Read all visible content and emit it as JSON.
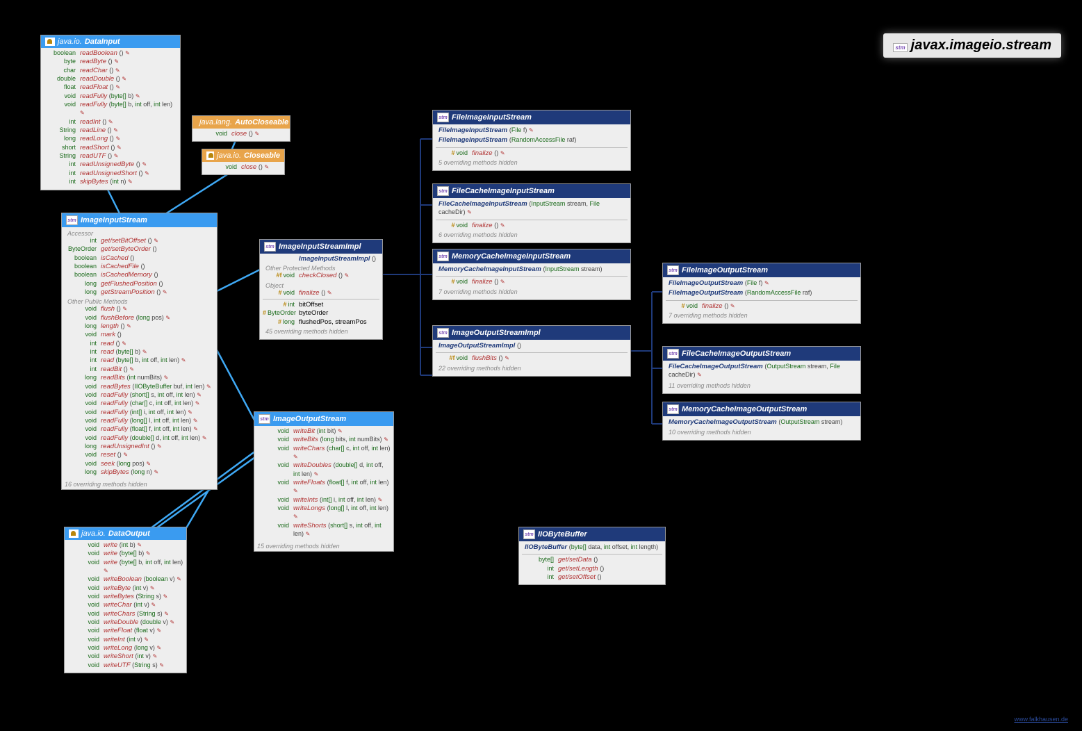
{
  "title": "javax.imageio.stream",
  "footer": "www.falkhausen.de",
  "colors": {
    "blue": "#3a9bf0",
    "navy": "#1f3a7a",
    "orange": "#e8a44a",
    "method": "#b03030",
    "type": "#1a6a1a"
  },
  "boxes": {
    "DataInput": {
      "header": {
        "pkg": "java.io.",
        "name": "DataInput",
        "style": "blue",
        "icon": "j"
      },
      "rows": [
        {
          "ret": "boolean",
          "name": "readBoolean",
          "params": "()",
          "e": true
        },
        {
          "ret": "byte",
          "name": "readByte",
          "params": "()",
          "e": true
        },
        {
          "ret": "char",
          "name": "readChar",
          "params": "()",
          "e": true
        },
        {
          "ret": "double",
          "name": "readDouble",
          "params": "()",
          "e": true
        },
        {
          "ret": "float",
          "name": "readFloat",
          "params": "()",
          "e": true
        },
        {
          "ret": "void",
          "name": "readFully",
          "params": "(byte[] b)",
          "e": true
        },
        {
          "ret": "void",
          "name": "readFully",
          "params": "(byte[] b, int off, int len)",
          "e": true
        },
        {
          "ret": "int",
          "name": "readInt",
          "params": "()",
          "e": true
        },
        {
          "ret": "String",
          "name": "readLine",
          "params": "()",
          "e": true
        },
        {
          "ret": "long",
          "name": "readLong",
          "params": "()",
          "e": true
        },
        {
          "ret": "short",
          "name": "readShort",
          "params": "()",
          "e": true
        },
        {
          "ret": "String",
          "name": "readUTF",
          "params": "()",
          "e": true
        },
        {
          "ret": "int",
          "name": "readUnsignedByte",
          "params": "()",
          "e": true
        },
        {
          "ret": "int",
          "name": "readUnsignedShort",
          "params": "()",
          "e": true
        },
        {
          "ret": "int",
          "name": "skipBytes",
          "params": "(int n)",
          "e": true
        }
      ]
    },
    "AutoCloseable": {
      "header": {
        "pkg": "java.lang.",
        "name": "AutoCloseable",
        "style": "orange",
        "icon": "cup"
      },
      "rows": [
        {
          "ret": "void",
          "name": "close",
          "params": "()",
          "e": true
        }
      ]
    },
    "Closeable": {
      "header": {
        "pkg": "java.io.",
        "name": "Closeable",
        "style": "orange",
        "icon": "j"
      },
      "rows": [
        {
          "ret": "void",
          "name": "close",
          "params": "()",
          "e": true
        }
      ]
    },
    "ImageInputStream": {
      "header": {
        "pkg": "",
        "name": "ImageInputStream",
        "style": "blue",
        "icon": "stm"
      },
      "sections": [
        {
          "title": "Accessor",
          "rows": [
            {
              "ret": "int",
              "name": "get/setBitOffset",
              "params": "()",
              "e": true
            },
            {
              "ret": "ByteOrder",
              "name": "get/setByteOrder",
              "params": "()"
            },
            {
              "ret": "boolean",
              "name": "isCached",
              "params": "()"
            },
            {
              "ret": "boolean",
              "name": "isCachedFile",
              "params": "()"
            },
            {
              "ret": "boolean",
              "name": "isCachedMemory",
              "params": "()"
            },
            {
              "ret": "long",
              "name": "getFlushedPosition",
              "params": "()"
            },
            {
              "ret": "long",
              "name": "getStreamPosition",
              "params": "()",
              "e": true
            }
          ]
        },
        {
          "title": "Other Public Methods",
          "rows": [
            {
              "ret": "void",
              "name": "flush",
              "params": "()",
              "e": true
            },
            {
              "ret": "void",
              "name": "flushBefore",
              "params": "(long pos)",
              "e": true
            },
            {
              "ret": "long",
              "name": "length",
              "params": "()",
              "e": true
            },
            {
              "ret": "void",
              "name": "mark",
              "params": "()"
            },
            {
              "ret": "int",
              "name": "read",
              "params": "()",
              "e": true
            },
            {
              "ret": "int",
              "name": "read",
              "params": "(byte[] b)",
              "e": true
            },
            {
              "ret": "int",
              "name": "read",
              "params": "(byte[] b, int off, int len)",
              "e": true
            },
            {
              "ret": "int",
              "name": "readBit",
              "params": "()",
              "e": true
            },
            {
              "ret": "long",
              "name": "readBits",
              "params": "(int numBits)",
              "e": true
            },
            {
              "ret": "void",
              "name": "readBytes",
              "params": "(IIOByteBuffer buf, int len)",
              "e": true
            },
            {
              "ret": "void",
              "name": "readFully",
              "params": "(short[] s, int off, int len)",
              "e": true
            },
            {
              "ret": "void",
              "name": "readFully",
              "params": "(char[] c, int off, int len)",
              "e": true
            },
            {
              "ret": "void",
              "name": "readFully",
              "params": "(int[] i, int off, int len)",
              "e": true
            },
            {
              "ret": "void",
              "name": "readFully",
              "params": "(long[] l, int off, int len)",
              "e": true
            },
            {
              "ret": "void",
              "name": "readFully",
              "params": "(float[] f, int off, int len)",
              "e": true
            },
            {
              "ret": "void",
              "name": "readFully",
              "params": "(double[] d, int off, int len)",
              "e": true
            },
            {
              "ret": "long",
              "name": "readUnsignedInt",
              "params": "()",
              "e": true
            },
            {
              "ret": "void",
              "name": "reset",
              "params": "()",
              "e": true
            },
            {
              "ret": "void",
              "name": "seek",
              "params": "(long pos)",
              "e": true
            },
            {
              "ret": "long",
              "name": "skipBytes",
              "params": "(long n)",
              "e": true
            }
          ]
        }
      ],
      "hidden": "16 overriding methods hidden"
    },
    "ImageInputStreamImpl": {
      "header": {
        "pkg": "",
        "name": "ImageInputStreamImpl",
        "style": "navy",
        "icon": "stm"
      },
      "ctor": [
        {
          "name": "ImageInputStreamImpl",
          "params": "()"
        }
      ],
      "sections": [
        {
          "title": "Other Protected Methods",
          "rows": [
            {
              "prot": "#f",
              "ret": "void",
              "name": "checkClosed",
              "params": "()",
              "e": true
            }
          ]
        },
        {
          "title": "Object",
          "rows": [
            {
              "prot": "#",
              "ret": "void",
              "name": "finalize",
              "params": "()",
              "e": true
            }
          ]
        }
      ],
      "fields": [
        {
          "prot": "#",
          "ret": "int",
          "name": "bitOffset"
        },
        {
          "prot": "#",
          "ret": "ByteOrder",
          "name": "byteOrder"
        },
        {
          "prot": "#",
          "ret": "long",
          "name": "flushedPos, streamPos"
        }
      ],
      "hidden": "45 overriding methods hidden"
    },
    "ImageOutputStream": {
      "header": {
        "pkg": "",
        "name": "ImageOutputStream",
        "style": "blue",
        "icon": "stm"
      },
      "rows": [
        {
          "ret": "void",
          "name": "writeBit",
          "params": "(int bit)",
          "e": true
        },
        {
          "ret": "void",
          "name": "writeBits",
          "params": "(long bits, int numBits)",
          "e": true
        },
        {
          "ret": "void",
          "name": "writeChars",
          "params": "(char[] c, int off, int len)",
          "e": true
        },
        {
          "ret": "void",
          "name": "writeDoubles",
          "params": "(double[] d, int off, int len)",
          "e": true
        },
        {
          "ret": "void",
          "name": "writeFloats",
          "params": "(float[] f, int off, int len)",
          "e": true
        },
        {
          "ret": "void",
          "name": "writeInts",
          "params": "(int[] i, int off, int len)",
          "e": true
        },
        {
          "ret": "void",
          "name": "writeLongs",
          "params": "(long[] l, int off, int len)",
          "e": true
        },
        {
          "ret": "void",
          "name": "writeShorts",
          "params": "(short[] s, int off, int len)",
          "e": true
        }
      ],
      "hidden": "15 overriding methods hidden"
    },
    "DataOutput": {
      "header": {
        "pkg": "java.io.",
        "name": "DataOutput",
        "style": "blue",
        "icon": "j"
      },
      "rows": [
        {
          "ret": "void",
          "name": "write",
          "params": "(int b)",
          "e": true
        },
        {
          "ret": "void",
          "name": "write",
          "params": "(byte[] b)",
          "e": true
        },
        {
          "ret": "void",
          "name": "write",
          "params": "(byte[] b, int off, int len)",
          "e": true
        },
        {
          "ret": "void",
          "name": "writeBoolean",
          "params": "(boolean v)",
          "e": true
        },
        {
          "ret": "void",
          "name": "writeByte",
          "params": "(int v)",
          "e": true
        },
        {
          "ret": "void",
          "name": "writeBytes",
          "params": "(String s)",
          "e": true
        },
        {
          "ret": "void",
          "name": "writeChar",
          "params": "(int v)",
          "e": true
        },
        {
          "ret": "void",
          "name": "writeChars",
          "params": "(String s)",
          "e": true
        },
        {
          "ret": "void",
          "name": "writeDouble",
          "params": "(double v)",
          "e": true
        },
        {
          "ret": "void",
          "name": "writeFloat",
          "params": "(float v)",
          "e": true
        },
        {
          "ret": "void",
          "name": "writeInt",
          "params": "(int v)",
          "e": true
        },
        {
          "ret": "void",
          "name": "writeLong",
          "params": "(long v)",
          "e": true
        },
        {
          "ret": "void",
          "name": "writeShort",
          "params": "(int v)",
          "e": true
        },
        {
          "ret": "void",
          "name": "writeUTF",
          "params": "(String s)",
          "e": true
        }
      ]
    },
    "FileImageInputStream": {
      "header": {
        "pkg": "",
        "name": "FileImageInputStream",
        "style": "navy",
        "icon": "stm"
      },
      "ctor": [
        {
          "name": "FileImageInputStream",
          "params": "(File f)",
          "e": true
        },
        {
          "name": "FileImageInputStream",
          "params": "(RandomAccessFile raf)"
        }
      ],
      "sep": true,
      "rows": [
        {
          "prot": "#",
          "ret": "void",
          "name": "finalize",
          "params": "()",
          "e": true
        }
      ],
      "hidden": "5 overriding methods hidden"
    },
    "FileCacheImageInputStream": {
      "header": {
        "pkg": "",
        "name": "FileCacheImageInputStream",
        "style": "navy",
        "icon": "stm"
      },
      "ctor": [
        {
          "name": "FileCacheImageInputStream",
          "params": "(InputStream stream, File cacheDir)",
          "e": true
        }
      ],
      "sep": true,
      "rows": [
        {
          "prot": "#",
          "ret": "void",
          "name": "finalize",
          "params": "()",
          "e": true
        }
      ],
      "hidden": "6 overriding methods hidden"
    },
    "MemoryCacheImageInputStream": {
      "header": {
        "pkg": "",
        "name": "MemoryCacheImageInputStream",
        "style": "navy",
        "icon": "stm"
      },
      "ctor": [
        {
          "name": "MemoryCacheImageInputStream",
          "params": "(InputStream stream)"
        }
      ],
      "sep": true,
      "rows": [
        {
          "prot": "#",
          "ret": "void",
          "name": "finalize",
          "params": "()",
          "e": true
        }
      ],
      "hidden": "7 overriding methods hidden"
    },
    "ImageOutputStreamImpl": {
      "header": {
        "pkg": "",
        "name": "ImageOutputStreamImpl",
        "style": "navy",
        "icon": "stm"
      },
      "ctor": [
        {
          "name": "ImageOutputStreamImpl",
          "params": "()"
        }
      ],
      "sep": true,
      "rows": [
        {
          "prot": "#f",
          "ret": "void",
          "name": "flushBits",
          "params": "()",
          "e": true
        }
      ],
      "hidden": "22 overriding methods hidden"
    },
    "FileImageOutputStream": {
      "header": {
        "pkg": "",
        "name": "FileImageOutputStream",
        "style": "navy",
        "icon": "stm"
      },
      "ctor": [
        {
          "name": "FileImageOutputStream",
          "params": "(File f)",
          "e": true
        },
        {
          "name": "FileImageOutputStream",
          "params": "(RandomAccessFile raf)"
        }
      ],
      "sep": true,
      "rows": [
        {
          "prot": "#",
          "ret": "void",
          "name": "finalize",
          "params": "()",
          "e": true
        }
      ],
      "hidden": "7 overriding methods hidden"
    },
    "FileCacheImageOutputStream": {
      "header": {
        "pkg": "",
        "name": "FileCacheImageOutputStream",
        "style": "navy",
        "icon": "stm"
      },
      "ctor": [
        {
          "name": "FileCacheImageOutputStream",
          "params": "(OutputStream stream, File cacheDir)",
          "e": true
        }
      ],
      "hidden": "11 overriding methods hidden"
    },
    "MemoryCacheImageOutputStream": {
      "header": {
        "pkg": "",
        "name": "MemoryCacheImageOutputStream",
        "style": "navy",
        "icon": "stm"
      },
      "ctor": [
        {
          "name": "MemoryCacheImageOutputStream",
          "params": "(OutputStream stream)"
        }
      ],
      "hidden": "10 overriding methods hidden"
    },
    "IIOByteBuffer": {
      "header": {
        "pkg": "",
        "name": "IIOByteBuffer",
        "style": "navy",
        "icon": "stm"
      },
      "ctor": [
        {
          "name": "IIOByteBuffer",
          "params": "(byte[] data, int offset, int length)"
        }
      ],
      "sep": true,
      "rows": [
        {
          "ret": "byte[]",
          "name": "get/setData",
          "params": "()"
        },
        {
          "ret": "int",
          "name": "get/setLength",
          "params": "()"
        },
        {
          "ret": "int",
          "name": "get/setOffset",
          "params": "()"
        }
      ]
    }
  }
}
